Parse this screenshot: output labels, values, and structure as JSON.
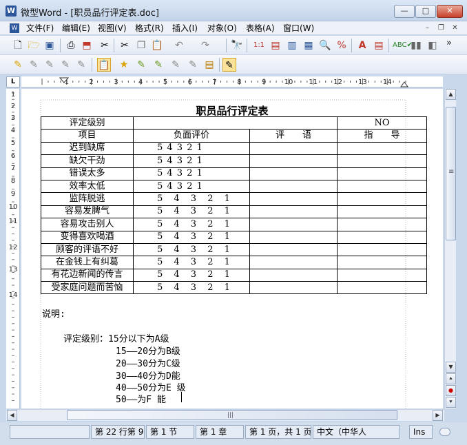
{
  "window": {
    "title": "微型Word - [职员品行评定表.doc]",
    "app_icon_letter": "W",
    "controls": {
      "minimize": "—",
      "maximize": "□",
      "close": "✕"
    }
  },
  "menubar": {
    "icon_letter": "W",
    "items": [
      "文件(F)",
      "编辑(E)",
      "视图(V)",
      "格式(R)",
      "插入(I)",
      "对象(O)",
      "表格(A)",
      "窗口(W)"
    ],
    "mdi_controls": {
      "minimize": "–",
      "restore": "❐",
      "close": "✕"
    }
  },
  "toolbar1": {
    "icons": [
      "new-doc-icon",
      "open-folder-icon",
      "save-icon",
      "print-icon",
      "pdf-icon",
      "cut-icon",
      "copy-icon",
      "paste-icon",
      "undo-icon",
      "redo-icon",
      "find-icon",
      "table-icon",
      "insert-row-icon",
      "text-box-icon",
      "columns-icon",
      "zoom-icon",
      "special-icon",
      "font-color-icon",
      "page-setup-icon",
      "spellcheck-icon",
      "chart-icon",
      "shading-icon"
    ],
    "more": "»"
  },
  "toolbar2": {
    "icons": [
      "style-1-icon",
      "style-2-icon",
      "style-3-icon",
      "style-4-icon",
      "style-5-icon",
      "format-paint-icon",
      "bookmark-1-icon",
      "bookmark-2-icon",
      "bookmark-3-icon",
      "bookmark-4-icon",
      "bookmark-5-icon",
      "note-icon",
      "edit-icon"
    ]
  },
  "ruler": {
    "corner_label": "L",
    "h_numbers": [
      "1",
      "2",
      "3",
      "4",
      "5",
      "6",
      "7",
      "8",
      "9",
      "10",
      "11",
      "12",
      "13",
      "14"
    ],
    "v_numbers": [
      "1",
      "2",
      "3",
      "4",
      "5",
      "6",
      "7",
      "8",
      "9",
      "10",
      "11",
      "12",
      "13",
      "14"
    ]
  },
  "document": {
    "title": "职员品行评定表",
    "table": {
      "row_level": {
        "label": "评定级别",
        "no_label": "NO"
      },
      "header": {
        "item": "项目",
        "negative": "负面评价",
        "comment": "评　　语",
        "guide": "指　　导"
      },
      "rows": [
        {
          "item": "迟到缺席",
          "scores": "5 4 3 2 1"
        },
        {
          "item": "缺欠干劲",
          "scores": "5 4 3 2 1"
        },
        {
          "item": "错误太多",
          "scores": "5 4 3 2 1"
        },
        {
          "item": "效率太低",
          "scores": "5 4 3 2 1"
        },
        {
          "item": "监阵脱逃",
          "scores": "5  4  3  2  1"
        },
        {
          "item": "容易发脾气",
          "scores": "5  4  3  2  1"
        },
        {
          "item": "容易攻击别人",
          "scores": "5  4  3  2  1"
        },
        {
          "item": "变得喜欢喝酒",
          "scores": "5  4  3  2  1"
        },
        {
          "item": "顾客的评语不好",
          "scores": "5  4  3  2  1"
        },
        {
          "item": "在金钱上有纠葛",
          "scores": "5  4  3  2  1"
        },
        {
          "item": "有花边新闻的传言",
          "scores": "5  4  3  2  1"
        },
        {
          "item": "受家庭问题而苦恼",
          "scores": "5  4  3  2  1"
        }
      ]
    },
    "notes": {
      "heading": "说明:",
      "lines": [
        "评定级别：15分以下为A级",
        "15——20分为B级",
        "20——30分为C级",
        "30——40分为D能",
        "40——50分为E 级",
        "50——为F 能"
      ]
    }
  },
  "vscroll": {
    "up": "▲",
    "down": "▼",
    "prev_page": "⯅",
    "next_page": "⯆",
    "browse": "●",
    "grip": "≡"
  },
  "hscroll": {
    "left": "◀",
    "right": "▶",
    "grip": "|||"
  },
  "statusbar": {
    "position": "第 22 行第 9",
    "section": "第 1 节",
    "chapter": "第 1 章",
    "page": "第 1 页，共 1 页",
    "language": "中文（中华人",
    "mode": "Ins"
  },
  "colors": {
    "accent": "#2b579a",
    "chrome": "#c9d8eb",
    "page": "#ffffff"
  }
}
